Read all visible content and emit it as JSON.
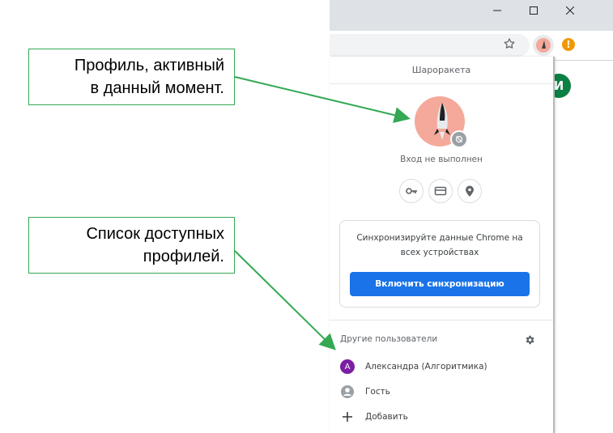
{
  "browser": {
    "window_controls": {
      "minimize": "−",
      "maximize": "□",
      "close": "✕"
    },
    "toolbar": {
      "bookmark_icon": "star-icon",
      "alert_glyph": "!"
    },
    "page_avatar_letter": "И"
  },
  "profile_menu": {
    "profile_name": "Шаpоракета",
    "status": "Вход не выполнен",
    "quick_actions": [
      "key-icon",
      "card-icon",
      "location-icon"
    ],
    "sync": {
      "text": "Синхронизируйте данные Chrome на всех устройствах",
      "button": "Включить синхронизацию"
    },
    "other_users_label": "Другие пользователи",
    "profiles": [
      {
        "label": "Александра (Алгоритмика)",
        "avatar_letter": "А",
        "avatar_color": "#7b1fa2"
      },
      {
        "label": "Гость",
        "icon": "guest-icon"
      },
      {
        "label": "Добавить",
        "icon": "plus-icon"
      }
    ]
  },
  "annotations": {
    "active_profile": [
      "Профиль, активный",
      "в данный момент."
    ],
    "profile_list": [
      "Список доступных",
      "профилей."
    ]
  },
  "colors": {
    "accent": "#1a73e8",
    "callout_border": "#34a853",
    "arrow": "#34a853"
  }
}
